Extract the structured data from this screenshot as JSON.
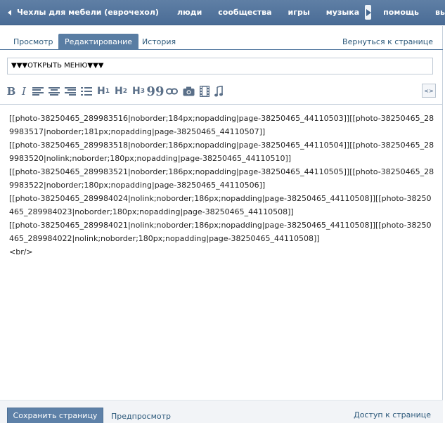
{
  "topbar": {
    "title": "Чехлы для мебели (еврочехол)",
    "nav": [
      "люди",
      "сообщества",
      "игры",
      "музыка"
    ],
    "nav_after": [
      "помощь",
      "выйти"
    ]
  },
  "tabs": [
    {
      "label": "Просмотр",
      "active": false
    },
    {
      "label": "Редактирование",
      "active": true
    },
    {
      "label": "История",
      "active": false
    }
  ],
  "return_link": "Вернуться к странице",
  "menu_text": "▼▼▼ОТКРЫТЬ МЕНЮ▼▼▼",
  "toolbar": {
    "bold": "B",
    "italic": "I",
    "h1": "H",
    "h1_sub": "1",
    "h2": "H",
    "h2_sub": "2",
    "h3": "H",
    "h3_sub": "3",
    "quote": "99",
    "source": "<>"
  },
  "editor_lines": [
    "[[photo-38250465_289983516|noborder;184px;nopadding|page-38250465_44110503]][[photo-38250465_289983517|noborder;181px;nopadding|page-38250465_44110507]]",
    "[[photo-38250465_289983518|noborder;186px;nopadding|page-38250465_44110504]][[photo-38250465_289983520|nolink;noborder;180px;nopadding|page-38250465_44110510]]",
    "[[photo-38250465_289983521|noborder;186px;nopadding|page-38250465_44110505]][[photo-38250465_289983522|noborder;180px;nopadding|page-38250465_44110506]]",
    "[[photo-38250465_289984024|nolink;noborder;186px;nopadding|page-38250465_44110508]][[photo-38250465_289984023|noborder;180px;nopadding|page-38250465_44110508]]",
    "[[photo-38250465_289984021|nolink;noborder;186px;nopadding|page-38250465_44110508]][[photo-38250465_289984022|nolink;noborder;180px;nopadding|page-38250465_44110508]]",
    "<br/>"
  ],
  "bottom": {
    "save": "Сохранить страницу",
    "preview": "Предпросмотр",
    "access": "Доступ к странице"
  }
}
